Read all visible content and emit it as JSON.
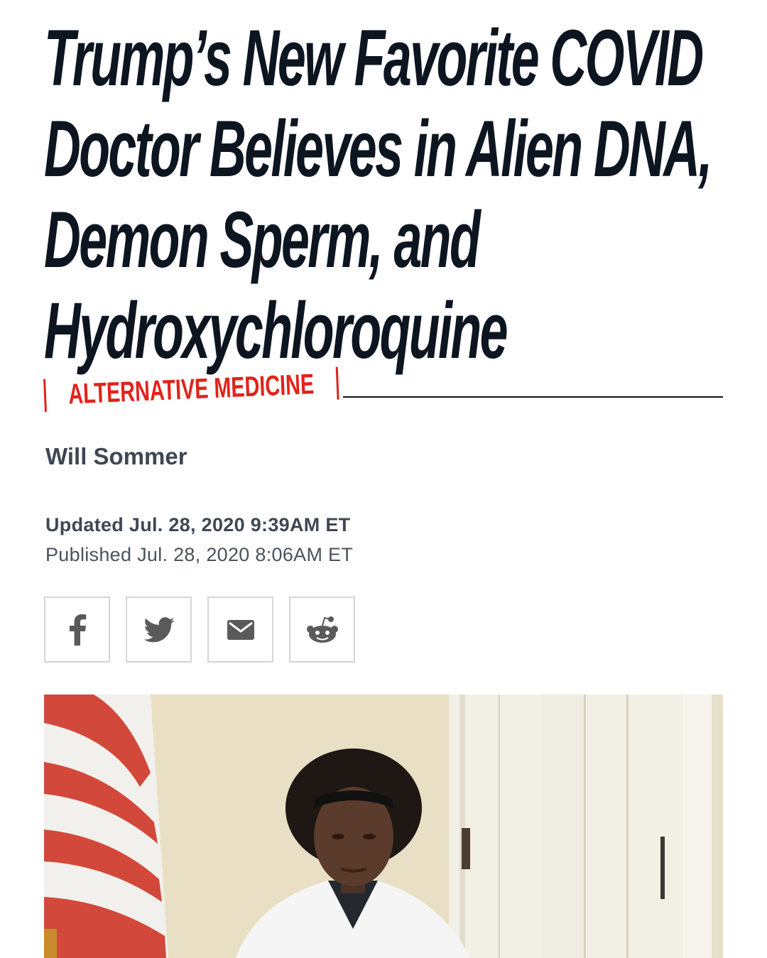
{
  "article": {
    "headline_lines": [
      "Trump’s New Favorite COVID",
      "Doctor Believes in Alien DNA,",
      "Demon Sperm, and",
      "Hydroxychloroquine"
    ],
    "category": "ALTERNATIVE MEDICINE",
    "author": "Will Sommer",
    "updated": "Updated Jul. 28, 2020 9:39AM ET",
    "published": "Published Jul. 28, 2020 8:06AM ET"
  },
  "share": {
    "icons": [
      "facebook-icon",
      "twitter-icon",
      "email-icon",
      "reddit-icon"
    ]
  },
  "colors": {
    "headline": "#0d1620",
    "category_accent": "#e2231a",
    "meta_text": "#3f4753",
    "share_border": "#d6d6d6"
  },
  "photo": {
    "subject": "woman in white coat beside american flag"
  }
}
